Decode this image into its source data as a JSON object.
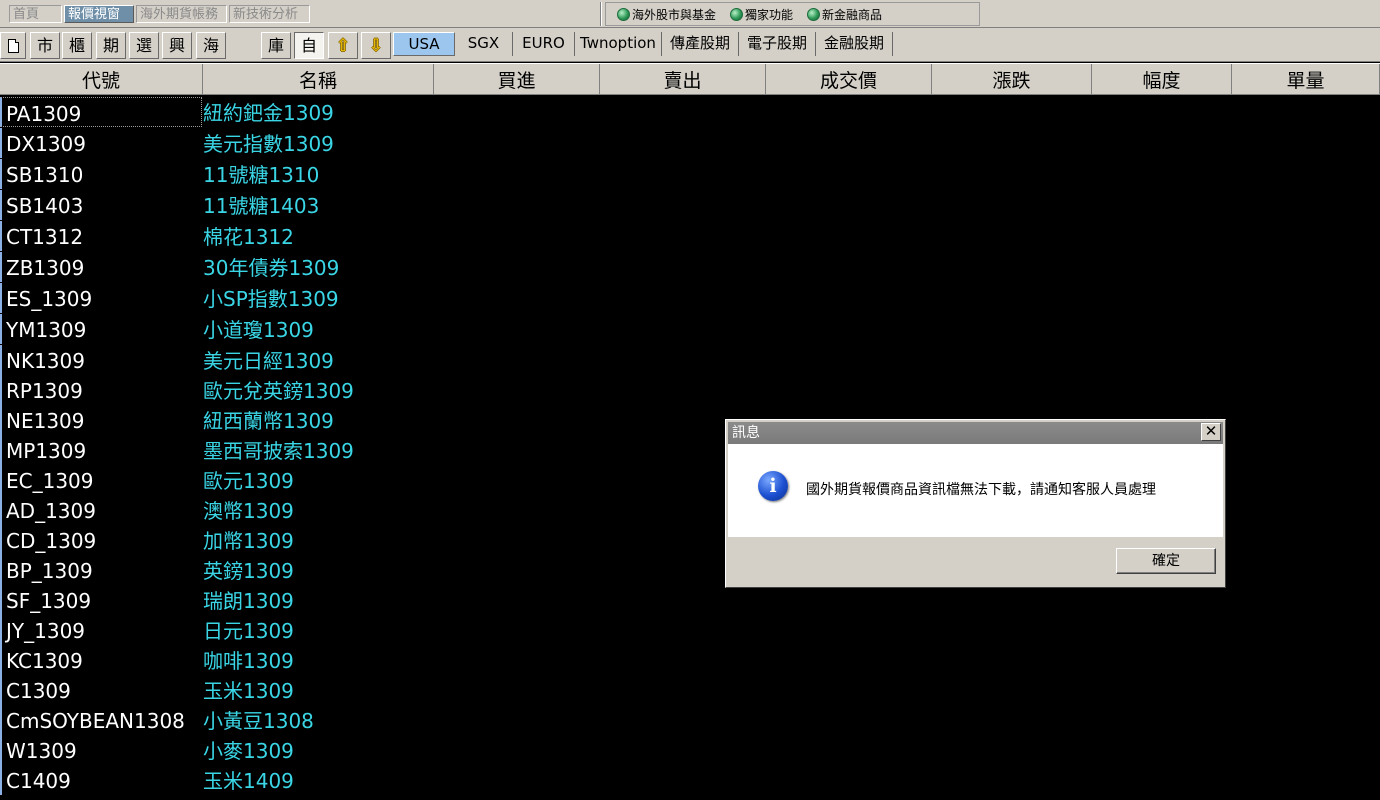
{
  "top_tabs": [
    {
      "label": "首頁",
      "active": false
    },
    {
      "label": "報價視窗",
      "active": true
    },
    {
      "label": "海外期貨帳務",
      "active": false
    },
    {
      "label": "新技術分析",
      "active": false
    }
  ],
  "globe_links": [
    "海外股市與基金",
    "獨家功能",
    "新金融商品"
  ],
  "toolbar": {
    "buttons": [
      "市",
      "櫃",
      "期",
      "選",
      "興",
      "海"
    ],
    "lib_label": "庫",
    "self_label": "自",
    "up_arrow": "⇧",
    "down_arrow": "⇩"
  },
  "market_tabs": [
    {
      "label": "USA",
      "active": true
    },
    {
      "label": "SGX",
      "active": false
    },
    {
      "label": "EURO",
      "active": false
    },
    {
      "label": "Twnoption",
      "active": false
    },
    {
      "label": "傳產股期",
      "active": false
    },
    {
      "label": "電子股期",
      "active": false
    },
    {
      "label": "金融股期",
      "active": false
    }
  ],
  "columns": [
    "代號",
    "名稱",
    "買進",
    "賣出",
    "成交價",
    "漲跌",
    "幅度",
    "單量"
  ],
  "rows": [
    {
      "code": "PA1309",
      "name": "紐約鈀金1309"
    },
    {
      "code": "DX1309",
      "name": "美元指數1309"
    },
    {
      "code": "SB1310",
      "name": "11號糖1310"
    },
    {
      "code": "SB1403",
      "name": "11號糖1403"
    },
    {
      "code": "CT1312",
      "name": "棉花1312"
    },
    {
      "code": "ZB1309",
      "name": "30年債券1309"
    },
    {
      "code": "ES_1309",
      "name": "小SP指數1309"
    },
    {
      "code": "YM1309",
      "name": "小道瓊1309"
    },
    {
      "code": "NK1309",
      "name": "美元日經1309"
    },
    {
      "code": "RP1309",
      "name": "歐元兌英鎊1309"
    },
    {
      "code": "NE1309",
      "name": "紐西蘭幣1309"
    },
    {
      "code": "MP1309",
      "name": "墨西哥披索1309"
    },
    {
      "code": "EC_1309",
      "name": "歐元1309"
    },
    {
      "code": "AD_1309",
      "name": "澳幣1309"
    },
    {
      "code": "CD_1309",
      "name": "加幣1309"
    },
    {
      "code": "BP_1309",
      "name": "英鎊1309"
    },
    {
      "code": "SF_1309",
      "name": "瑞朗1309"
    },
    {
      "code": "JY_1309",
      "name": "日元1309"
    },
    {
      "code": "KC1309",
      "name": "咖啡1309"
    },
    {
      "code": "C1309",
      "name": "玉米1309"
    },
    {
      "code": "CmSOYBEAN1308",
      "name": "小黃豆1308"
    },
    {
      "code": "W1309",
      "name": "小麥1309"
    },
    {
      "code": "C1409",
      "name": "玉米1409"
    }
  ],
  "dialog": {
    "title": "訊息",
    "close_glyph": "✕",
    "message": "國外期貨報價商品資訊檔無法下載，請通知客服人員處理",
    "ok_label": "確定",
    "info_glyph": "i"
  },
  "colors": {
    "background": "#000000",
    "chrome": "#d4d0c8",
    "code_text": "#ffffff",
    "name_text": "#3ad6e6",
    "active_market_tab": "#9cc6ee",
    "active_top_tab": "#6f8fa8"
  }
}
